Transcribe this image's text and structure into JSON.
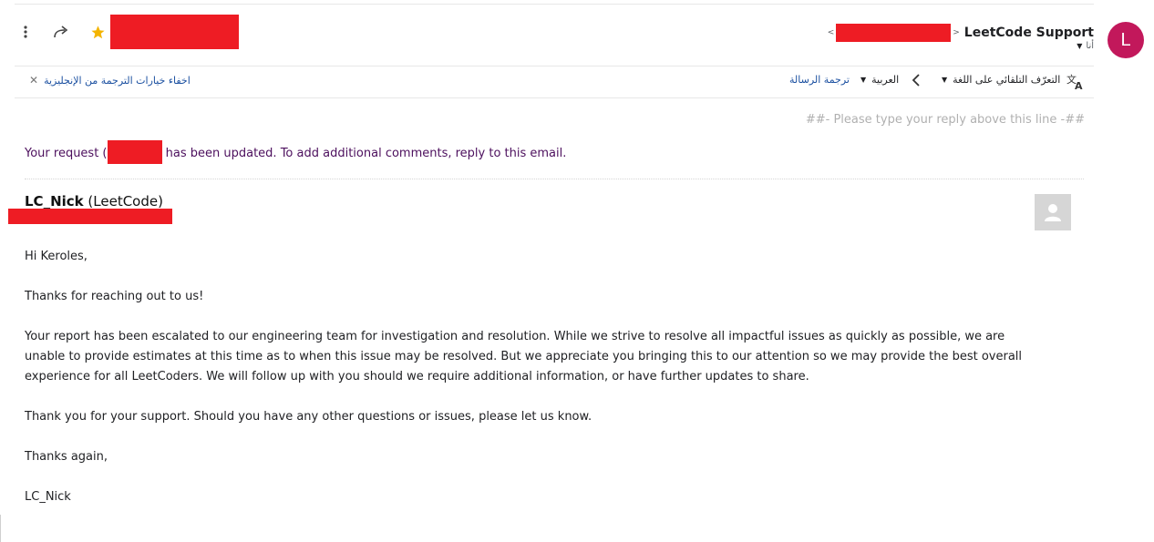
{
  "header": {
    "sender_name": "LeetCode Support",
    "sender_angle_open": "<",
    "sender_angle_close": ">",
    "to_label": "أنا",
    "avatar_letter": "L",
    "avatar_color": "#c2185b",
    "star_color": "#f4b400"
  },
  "translate_bar": {
    "detect_language": "التعرّف التلقائي على اللغة",
    "target_language": "العربية",
    "translate_message": "ترجمة الرسالة",
    "hide_options": "اخفاء خيارات الترجمة من الإنجليزية"
  },
  "email": {
    "reply_marker": "##- Please type your reply above this line -##",
    "update_prefix": "Your request (",
    "update_suffix": " has been updated. To add additional comments, reply to this email.",
    "author_name": "LC_Nick",
    "author_org": "(LeetCode)",
    "greeting": "Hi Keroles,",
    "p1": "Thanks for reaching out to us!",
    "p2": "Your report has been escalated to our engineering team for investigation and resolution. While we strive to resolve all impactful issues as quickly as possible, we are unable to provide estimates at this time as to when this issue may be resolved. But we appreciate you bringing this to our attention so we may provide the best overall experience for all LeetCoders. We will follow up with you should we require additional information, or have further updates to share.",
    "p3": "Thank you for your support.  Should you have any other questions or issues, please let us know.",
    "p4": "Thanks again,",
    "signature": "LC_Nick"
  }
}
